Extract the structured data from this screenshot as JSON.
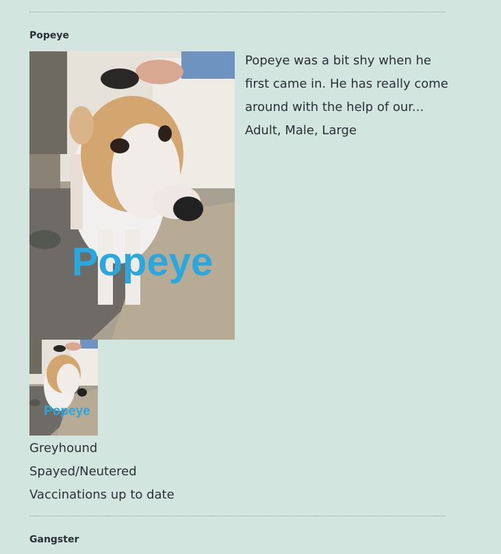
{
  "listing": [
    {
      "name": "Popeye",
      "description": "Popeye was a bit shy when he first came in. He has really come around with the help of our...",
      "attributes": "Adult, Male, Large",
      "photo_label": "Popeye",
      "breed": "Greyhound",
      "spayed_neutered": "Spayed/Neutered",
      "vaccinations": "Vaccinations up to date"
    },
    {
      "name": "Gangster"
    }
  ],
  "colors": {
    "page_background": "#d2e5df",
    "text": "#2b2f36",
    "photo_caption": "#29a8e0",
    "divider": "#8c9a96"
  },
  "icons": {
    "main_photo": "dog-photo",
    "thumbnail_photo": "dog-photo-thumbnail"
  }
}
